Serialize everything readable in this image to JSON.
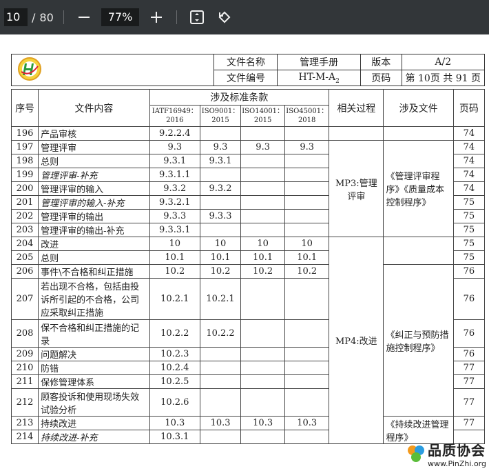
{
  "toolbar": {
    "page_current": "10",
    "page_sep": "/",
    "page_total": "80",
    "zoom": "77%",
    "zoom_out_icon": "minus-icon",
    "zoom_in_icon": "plus-icon",
    "fit_icon": "fit-page-icon",
    "rotate_icon": "rotate-icon"
  },
  "header": {
    "doc_name_label": "文件名称",
    "doc_name_value": "管理手册",
    "version_label": "版本",
    "version_value": "A/2",
    "doc_no_label": "文件编号",
    "doc_no_value": "HT-M-A",
    "doc_no_sub": "2",
    "page_label": "页码",
    "page_value": "第 10页 共 91 页"
  },
  "table": {
    "col_no": "序号",
    "col_content": "文件内容",
    "col_std_group": "涉及标准条款",
    "col_std1": "IATF16949：2016",
    "col_std2": "ISO9001：2015",
    "col_std3": "ISO14001：2015",
    "col_std4": "ISO45001：2018",
    "col_process": "相关过程",
    "col_files": "涉及文件",
    "col_page": "页码",
    "rows": [
      {
        "no": "196",
        "content": "产品审核",
        "s1": "9.2.2.4",
        "s2": "",
        "s3": "",
        "s4": "",
        "page": "74"
      },
      {
        "no": "197",
        "content": "管理评审",
        "s1": "9.3",
        "s2": "9.3",
        "s3": "9.3",
        "s4": "9.3",
        "page": "74"
      },
      {
        "no": "198",
        "content": "总则",
        "s1": "9.3.1",
        "s2": "9.3.1",
        "s3": "",
        "s4": "",
        "page": "74"
      },
      {
        "no": "199",
        "content": "管理评审-补充",
        "s1": "9.3.1.1",
        "s2": "",
        "s3": "",
        "s4": "",
        "page": "74"
      },
      {
        "no": "200",
        "content": "管理评审的输入",
        "s1": "9.3.2",
        "s2": "9.3.2",
        "s3": "",
        "s4": "",
        "page": "74"
      },
      {
        "no": "201",
        "content": "管理评审的输入-补充",
        "s1": "9.3.2.1",
        "s2": "",
        "s3": "",
        "s4": "",
        "page": "75"
      },
      {
        "no": "202",
        "content": "管理评审的输出",
        "s1": "9.3.3",
        "s2": "9.3.3",
        "s3": "",
        "s4": "",
        "page": "75"
      },
      {
        "no": "203",
        "content": "管理评审的输出-补充",
        "s1": "9.3.3.1",
        "s2": "",
        "s3": "",
        "s4": "",
        "page": "75"
      },
      {
        "no": "204",
        "content": "改进",
        "s1": "10",
        "s2": "10",
        "s3": "10",
        "s4": "10",
        "page": "75"
      },
      {
        "no": "205",
        "content": "总则",
        "s1": "10.1",
        "s2": "10.1",
        "s3": "10.1",
        "s4": "10.1",
        "page": "75"
      },
      {
        "no": "206",
        "content": "事件\\不合格和纠正措施",
        "s1": "10.2",
        "s2": "10.2",
        "s3": "10.2",
        "s4": "10.2",
        "page": "76"
      },
      {
        "no": "207",
        "content": "若出现不合格，包括由投诉所引起的不合格，公司应采取纠正措施",
        "s1": "10.2.1",
        "s2": "10.2.1",
        "s3": "",
        "s4": "",
        "page": "76"
      },
      {
        "no": "208",
        "content": "保不合格和纠正措施的记录",
        "s1": "10.2.2",
        "s2": "10.2.2",
        "s3": "",
        "s4": "",
        "page": "76"
      },
      {
        "no": "209",
        "content": "问题解决",
        "s1": "10.2.3",
        "s2": "",
        "s3": "",
        "s4": "",
        "page": "76"
      },
      {
        "no": "210",
        "content": "防错",
        "s1": "10.2.4",
        "s2": "",
        "s3": "",
        "s4": "",
        "page": "77"
      },
      {
        "no": "211",
        "content": "保修管理体系",
        "s1": "10.2.5",
        "s2": "",
        "s3": "",
        "s4": "",
        "page": "77"
      },
      {
        "no": "212",
        "content": "顾客投诉和使用现场失效试验分析",
        "s1": "10.2.6",
        "s2": "",
        "s3": "",
        "s4": "",
        "page": "77"
      },
      {
        "no": "213",
        "content": "持续改进",
        "s1": "10.3",
        "s2": "10.3",
        "s3": "10.3",
        "s4": "10.3",
        "page": "77"
      },
      {
        "no": "214",
        "content": "持续改进-补充",
        "s1": "10.3.1",
        "s2": "",
        "s3": "",
        "s4": "",
        "page": ""
      }
    ],
    "proc_mp3": "MP3:管理评审",
    "proc_mp4": "MP4:改进",
    "files_mp3": "《管理评审程序》《质量成本控制程序》",
    "files_mp4": "《纠正与预防措施控制程序》",
    "files_last": "《持续改进管理程序》"
  },
  "watermark": {
    "title": "品质协会",
    "url": "www.PinZhi.org"
  }
}
